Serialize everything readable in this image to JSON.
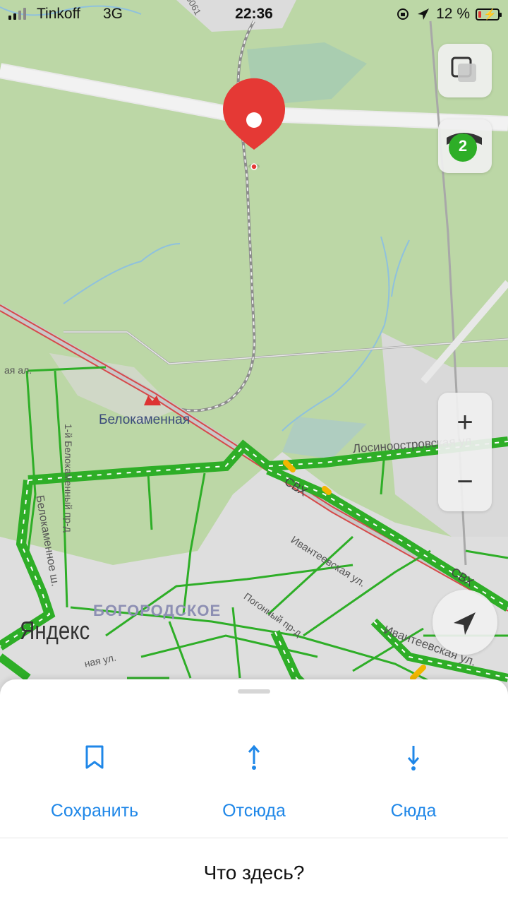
{
  "status_bar": {
    "carrier": "Tinkoff",
    "network": "3G",
    "time": "22:36",
    "battery_percent": "12 %",
    "battery_level": 0.12
  },
  "map": {
    "metro_station": "Белокаменная",
    "district": "БОГОРОДСКОЕ",
    "watermark": "Яндекс",
    "route_marker": "5061",
    "street_labels": {
      "losinoostrovskaya": "Лосиноостровская ул.",
      "belokamenny_pr": "1-й Белокаменный пр-д",
      "belokamennoe_sh": "Белокаменное ш.",
      "ivanteevskaya_1": "Ивантеевская ул.",
      "ivanteevskaya_2": "Ивантеевская ул.",
      "pogonny_pr": "Погонный пр-д",
      "svkh_1": "СВХ",
      "svkh_2": "СВХ",
      "left_edge_1": "ая ал.",
      "left_edge_2": "ная ул."
    },
    "traffic_level": "2",
    "zoom_in_label": "+",
    "zoom_out_label": "−",
    "colors": {
      "land": "#bcd7a6",
      "urban": "#dcdcdc",
      "traffic_free": "#2eae27",
      "traffic_slow": "#f2b600",
      "pin": "#e53935",
      "railway": "#d64a4a"
    }
  },
  "bottom_sheet": {
    "actions": [
      {
        "label": "Сохранить",
        "icon": "bookmark-icon"
      },
      {
        "label": "Отсюда",
        "icon": "arrow-up-icon"
      },
      {
        "label": "Сюда",
        "icon": "arrow-down-icon"
      }
    ],
    "whats_here": "Что здесь?",
    "accent_color": "#1f87e8"
  }
}
